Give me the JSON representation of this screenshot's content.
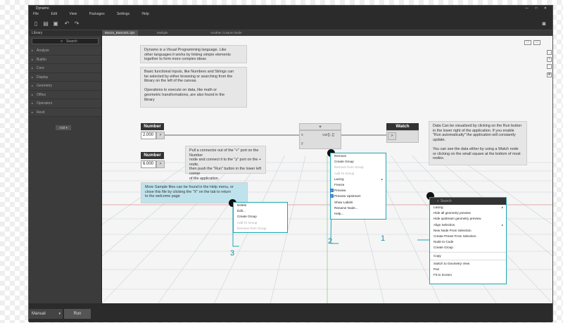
{
  "window": {
    "title": "Dynamo",
    "controls": [
      "—",
      "□",
      "✕"
    ]
  },
  "menu": [
    "File",
    "Edit",
    "View",
    "Packages",
    "Settings",
    "Help"
  ],
  "tabs": [
    {
      "label": "Basics_Basics01.dyn",
      "active": true
    },
    {
      "label": "Multiple",
      "active": false
    },
    {
      "label": "Another Custom Node",
      "active": false
    }
  ],
  "library": {
    "title": "Library",
    "search_placeholder": "Search",
    "categories": [
      "Analyze",
      "BuiltIn",
      "Core",
      "Display",
      "Geometry",
      "Office",
      "Operators",
      "Revit"
    ],
    "add_label": "Add ▾"
  },
  "notes": {
    "intro": "Dynamo is a Visual Programming language.  Like\nother languages it works by linking simple elements\ntogether to form more complex ideas",
    "basic": "Basic functional inputs, like Numbers and Strings can\nbe selected by either browsing or searching from the\nlibrary on the left of the canvas.\n\nOperations to execute on data, like math or\ngeometric transformations, are also found in the\nlibrary",
    "connector": "Pull a connector out of the \"+\" port on the Number\nnode and connect it to the \"y\" port on the + node,\nthen push the \"Run\" button in the lower left corner\nof the application.",
    "watch": "Data Can be visualized by clicking on the Run button\nin the lower right of the application.  If you enable\n\"Run automatically\" the application will constantly\nupdate.\n\nYou can see the data either by using a Watch node\nor clicking on the small square at the bottom of most\nnodes.",
    "samples": "More Sample files can be found in the Help menu, or\nclose this file by clicking the \"X\" on the tab to return\nto the welcome page"
  },
  "nodes": {
    "number1": {
      "title": "Number",
      "value": "2.000",
      "arrow": ">"
    },
    "number2": {
      "title": "Number",
      "value": "6.000",
      "arrow": ">"
    },
    "plus": {
      "title": "+",
      "port_x": "x",
      "port_y": "y",
      "output": "var[]..[]"
    },
    "watch": {
      "title": "Watch",
      "port": ">"
    }
  },
  "menu3": [
    "Delete",
    "Edit...",
    "Create Group",
    "Add To Group",
    "Remove from Group"
  ],
  "menu2": [
    {
      "label": "Remove",
      "disabled": false
    },
    {
      "label": "Create Group",
      "disabled": false
    },
    {
      "label": "Remove from Group",
      "disabled": true
    },
    {
      "label": "Add To Group",
      "disabled": true
    },
    {
      "label": "Lacing",
      "disabled": false,
      "sub": "▸"
    },
    {
      "label": "Freeze",
      "disabled": false
    },
    {
      "label": "Preview",
      "disabled": false,
      "checked": true
    },
    {
      "label": "Preview Upstream",
      "disabled": false,
      "checked": true
    },
    {
      "label": "Show Labels",
      "disabled": false
    },
    {
      "label": "Rename Node...",
      "disabled": false
    },
    {
      "label": "Help...",
      "disabled": false
    }
  ],
  "menu1": {
    "search_placeholder": "Search",
    "items": [
      {
        "label": "Lacing",
        "sub": "▸"
      },
      {
        "label": "Hide all geometry preview"
      },
      {
        "label": "Hide upstream geometry preview"
      },
      {
        "label": "Align Selection",
        "sub": "▸"
      },
      {
        "label": "New Node From Selection"
      },
      {
        "label": "Create Preset From Selection"
      },
      {
        "label": "Node to Code"
      },
      {
        "label": "Create Group"
      },
      {
        "label": "Copy"
      },
      {
        "label": "Switch to Geometry View"
      },
      {
        "label": "Pan"
      },
      {
        "label": "Fit to Screen"
      }
    ]
  },
  "callouts": [
    "1",
    "2",
    "3"
  ],
  "bottom": {
    "run_mode": "Manual",
    "run_label": "Run"
  },
  "colors": {
    "accent": "#1aa7b3",
    "chrome": "#2b2b2b"
  }
}
